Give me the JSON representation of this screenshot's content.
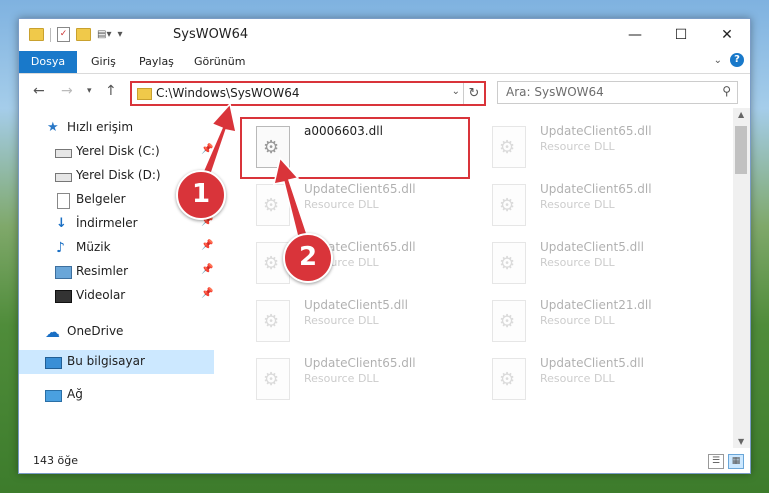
{
  "window": {
    "title": "SysWOW64"
  },
  "ribbon": {
    "tabs": [
      "Dosya",
      "Giriş",
      "Paylaş",
      "Görünüm"
    ]
  },
  "addressbar": {
    "path": "C:\\Windows\\SysWOW64"
  },
  "search": {
    "placeholder": "Ara: SysWOW64"
  },
  "sidebar": {
    "items": [
      {
        "label": "Hızlı erişim"
      },
      {
        "label": "Yerel Disk (C:)"
      },
      {
        "label": "Yerel Disk (D:)"
      },
      {
        "label": "Belgeler"
      },
      {
        "label": "İndirmeler"
      },
      {
        "label": "Müzik"
      },
      {
        "label": "Resimler"
      },
      {
        "label": "Videolar"
      },
      {
        "label": "OneDrive"
      },
      {
        "label": "Bu bilgisayar"
      },
      {
        "label": "Ağ"
      }
    ]
  },
  "files": [
    {
      "name": "a0006603.dll",
      "type": ""
    },
    {
      "name": "UpdateClient65.dll",
      "type": "Resource DLL"
    },
    {
      "name": "UpdateClient65.dll",
      "type": "Resource DLL"
    },
    {
      "name": "UpdateClient65.dll",
      "type": "Resource DLL"
    },
    {
      "name": "UpdateClient65.dll",
      "type": "Resource DLL"
    },
    {
      "name": "UpdateClient5.dll",
      "type": "Resource DLL"
    },
    {
      "name": "UpdateClient5.dll",
      "type": "Resource DLL"
    },
    {
      "name": "UpdateClient21.dll",
      "type": "Resource DLL"
    },
    {
      "name": "UpdateClient65.dll",
      "type": "Resource DLL"
    },
    {
      "name": "UpdateClient5.dll",
      "type": "Resource DLL"
    }
  ],
  "status": {
    "count": "143 öğe"
  },
  "annotations": {
    "step1": "1",
    "step2": "2"
  },
  "colors": {
    "accent": "#1979ca",
    "annotation": "#d9343a",
    "selection": "#cce8ff"
  }
}
